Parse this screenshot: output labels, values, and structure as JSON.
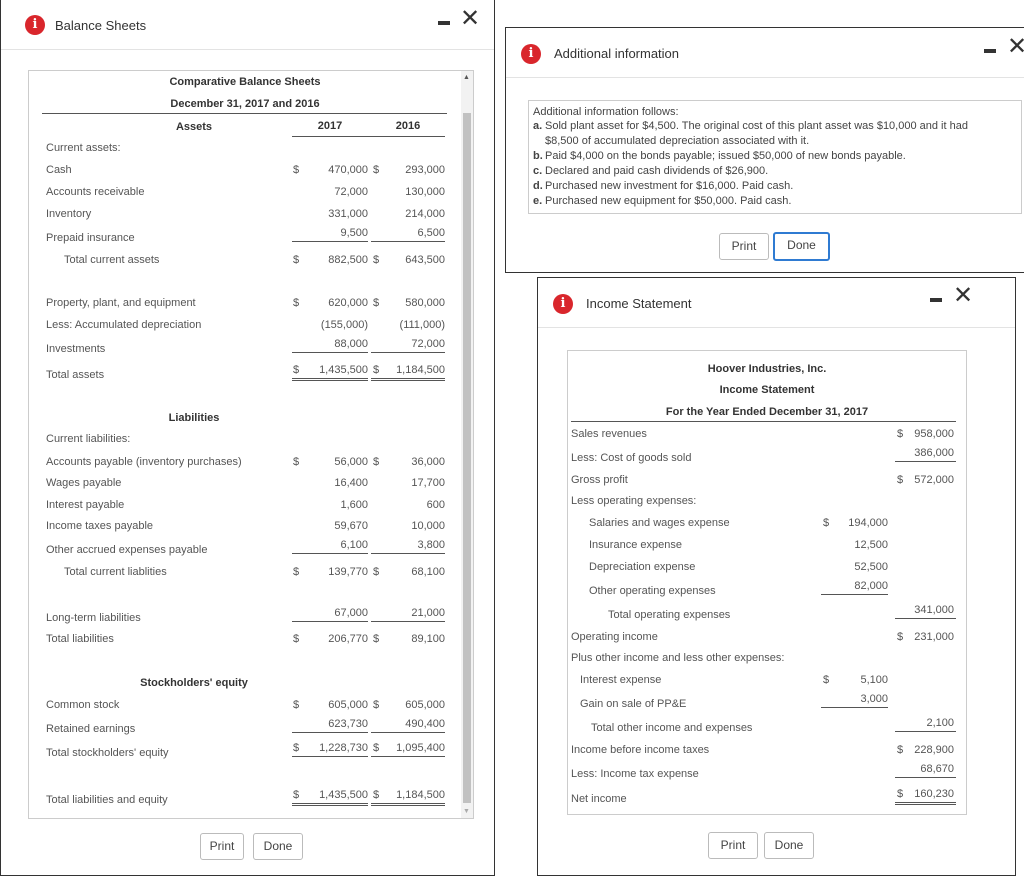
{
  "balance_window": {
    "title": "Balance Sheets",
    "icon": "info-icon",
    "print_label": "Print",
    "done_label": "Done",
    "heading": "Comparative Balance Sheets",
    "subheading": "December 31, 2017 and 2016",
    "assets_header": "Assets",
    "col_2017": "2017",
    "col_2016": "2016",
    "rows": [
      {
        "label": "Current assets:"
      },
      {
        "label": "Cash",
        "d1": "$",
        "v1": "470,000",
        "d2": "$",
        "v2": "293,000"
      },
      {
        "label": "Accounts receivable",
        "v1": "72,000",
        "v2": "130,000"
      },
      {
        "label": "Inventory",
        "v1": "331,000",
        "v2": "214,000"
      },
      {
        "label": "Prepaid insurance",
        "v1": "9,500",
        "v2": "6,500",
        "line": "single"
      },
      {
        "label": "Total current assets",
        "indent": true,
        "d1": "$",
        "v1": "882,500",
        "d2": "$",
        "v2": "643,500"
      },
      {
        "label": "Property, plant, and equipment",
        "d1": "$",
        "v1": "620,000",
        "d2": "$",
        "v2": "580,000"
      },
      {
        "label": "Less: Accumulated depreciation",
        "v1": "(155,000)",
        "v2": "(111,000)"
      },
      {
        "label": "Investments",
        "v1": "88,000",
        "v2": "72,000",
        "line": "single"
      },
      {
        "label": "Total assets",
        "d1": "$",
        "v1": "1,435,500",
        "d2": "$",
        "v2": "1,184,500",
        "line": "double"
      },
      {
        "label": "Liabilities",
        "heading": true
      },
      {
        "label": "Current liabilities:"
      },
      {
        "label": "Accounts payable (inventory purchases)",
        "d1": "$",
        "v1": "56,000",
        "d2": "$",
        "v2": "36,000"
      },
      {
        "label": "Wages payable",
        "v1": "16,400",
        "v2": "17,700"
      },
      {
        "label": "Interest payable",
        "v1": "1,600",
        "v2": "600"
      },
      {
        "label": "Income taxes payable",
        "v1": "59,670",
        "v2": "10,000"
      },
      {
        "label": "Other accrued expenses payable",
        "v1": "6,100",
        "v2": "3,800",
        "line": "single"
      },
      {
        "label": "Total current liablities",
        "indent": true,
        "d1": "$",
        "v1": "139,770",
        "d2": "$",
        "v2": "68,100"
      },
      {
        "label": "Long-term liabilities",
        "v1": "67,000",
        "v2": "21,000",
        "line": "single"
      },
      {
        "label": "Total liabilities",
        "d1": "$",
        "v1": "206,770",
        "d2": "$",
        "v2": "89,100"
      },
      {
        "label": "Stockholders' equity",
        "heading": true
      },
      {
        "label": "Common stock",
        "d1": "$",
        "v1": "605,000",
        "d2": "$",
        "v2": "605,000"
      },
      {
        "label": "Retained earnings",
        "v1": "623,730",
        "v2": "490,400",
        "line": "single"
      },
      {
        "label": "Total stockholders' equity",
        "d1": "$",
        "v1": "1,228,730",
        "d2": "$",
        "v2": "1,095,400",
        "line": "single"
      },
      {
        "label": "Total liabilities and equity",
        "d1": "$",
        "v1": "1,435,500",
        "d2": "$",
        "v2": "1,184,500",
        "line": "double"
      }
    ]
  },
  "additional_window": {
    "title": "Additional information",
    "icon": "info-icon",
    "print_label": "Print",
    "done_label": "Done",
    "intro": "Additional information follows:",
    "items": [
      {
        "letter": "a.",
        "text": "Sold plant asset for $4,500. The original cost of this plant asset was $10,000 and it had",
        "text2": "$8,500 of accumulated depreciation associated with it."
      },
      {
        "letter": "b.",
        "text": "Paid $4,000 on the bonds payable; issued $50,000 of new bonds payable."
      },
      {
        "letter": "c.",
        "text": "Declared and paid cash dividends of $26,900."
      },
      {
        "letter": "d.",
        "text": "Purchased new investment for $16,000. Paid cash."
      },
      {
        "letter": "e.",
        "text": "Purchased new equipment for $50,000. Paid cash."
      }
    ]
  },
  "income_window": {
    "title": "Income Statement",
    "icon": "info-icon",
    "print_label": "Print",
    "done_label": "Done",
    "company": "Hoover Industries, Inc.",
    "statement": "Income Statement",
    "period": "For the Year Ended December 31, 2017",
    "rows": [
      {
        "label": "Sales revenues",
        "d2": "$",
        "v2": "958,000"
      },
      {
        "label": "Less: Cost of goods sold",
        "v2": "386,000",
        "line2": "single"
      },
      {
        "label": "Gross profit",
        "d2": "$",
        "v2": "572,000"
      },
      {
        "label": "Less operating expenses:"
      },
      {
        "label": "Salaries and wages expense",
        "indent": 1,
        "d1": "$",
        "v1": "194,000"
      },
      {
        "label": "Insurance expense",
        "indent": 1,
        "v1": "12,500"
      },
      {
        "label": "Depreciation expense",
        "indent": 1,
        "v1": "52,500"
      },
      {
        "label": "Other operating expenses",
        "indent": 1,
        "v1": "82,000",
        "line1": "single"
      },
      {
        "label": "Total operating expenses",
        "indent": 2,
        "v2": "341,000",
        "line2": "single"
      },
      {
        "label": "Operating income",
        "d2": "$",
        "v2": "231,000"
      },
      {
        "label": "Plus other income and less other expenses:"
      },
      {
        "label": "Interest expense",
        "indent": 3,
        "d1": "$",
        "v1": "5,100"
      },
      {
        "label": "Gain on sale of PP&E",
        "indent": 3,
        "v1": "3,000",
        "line1": "single"
      },
      {
        "label": "Total other income and expenses",
        "indent": 4,
        "v2": "2,100",
        "line2": "single"
      },
      {
        "label": "Income before income taxes",
        "d2": "$",
        "v2": "228,900"
      },
      {
        "label": "Less: Income tax expense",
        "v2": "68,670",
        "line2": "single"
      },
      {
        "label": "Net income",
        "d2": "$",
        "v2": "160,230",
        "line2": "double"
      }
    ]
  },
  "colors": {
    "info": "#d9262c",
    "focus": "#2f7bd2"
  }
}
